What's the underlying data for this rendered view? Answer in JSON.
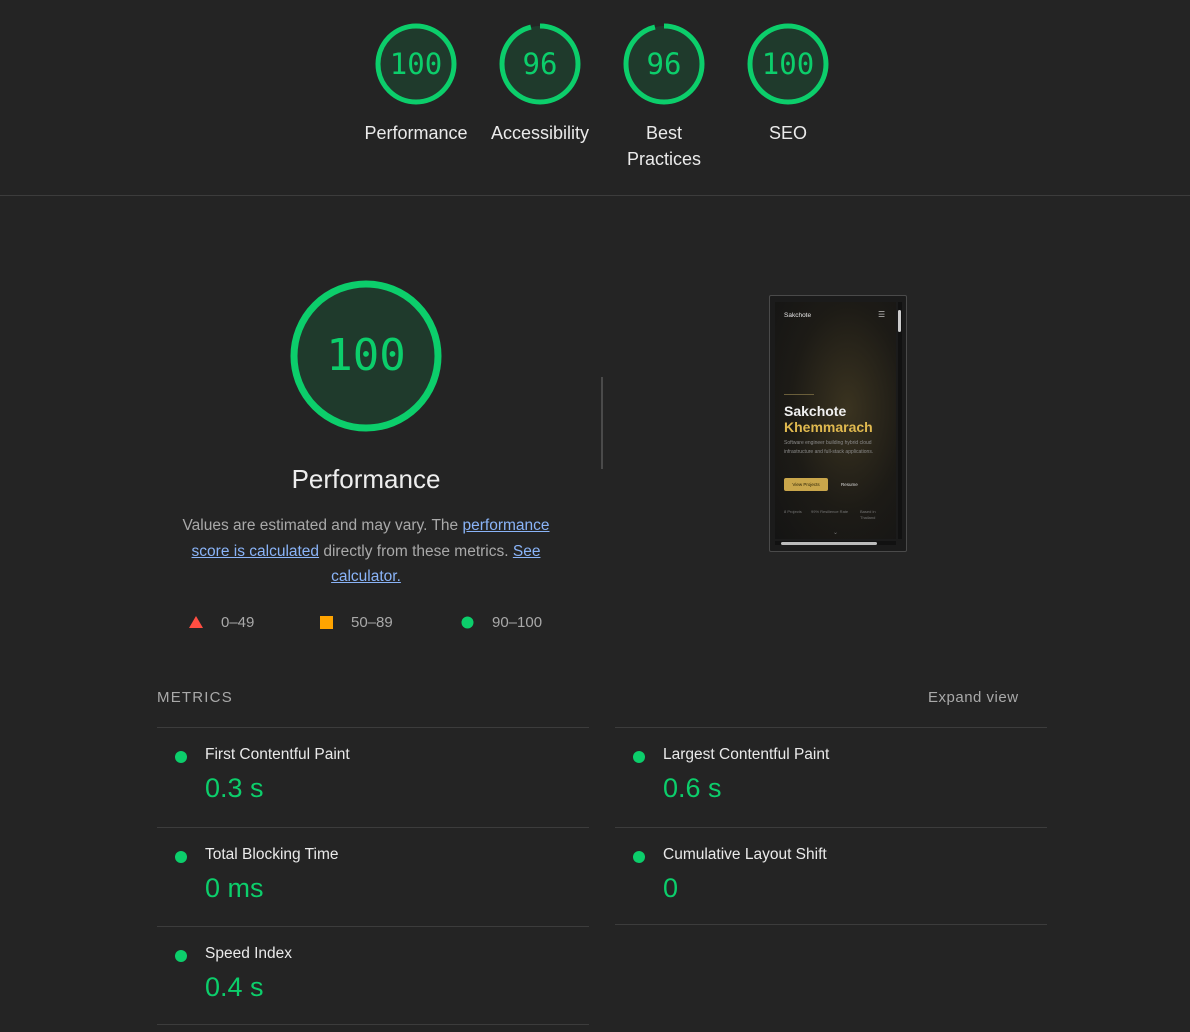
{
  "summary_gauges": [
    {
      "score": "100",
      "label_line1": "Performance",
      "label_line2": ""
    },
    {
      "score": "96",
      "label_line1": "Accessibility",
      "label_line2": ""
    },
    {
      "score": "96",
      "label_line1": "Best",
      "label_line2": "Practices"
    },
    {
      "score": "100",
      "label_line1": "SEO",
      "label_line2": ""
    }
  ],
  "performance": {
    "score": "100",
    "title": "Performance",
    "desc_prefix": "Values are estimated and may vary. The ",
    "desc_link1": "performance score is calculated",
    "desc_middle": " directly from these metrics. ",
    "desc_link2": "See calculator.",
    "legend": {
      "fail": "0–49",
      "average": "50–89",
      "pass": "90–100"
    }
  },
  "screenshot": {
    "brand": "Sakchote",
    "menu_icon": "☰",
    "name_first": "Sakchote",
    "name_last": "Khemmarach",
    "tagline": "Software engineer building hybrid cloud infrastructure and full-stack applications.",
    "primary_button": "View Projects",
    "secondary_button": "Resume",
    "stats": [
      "8 Projects",
      "99% Resilience Rate",
      "Based in Thailand"
    ],
    "chevron": "⌄"
  },
  "metrics": {
    "heading": "METRICS",
    "expand_label": "Expand view",
    "items": [
      {
        "name": "First Contentful Paint",
        "value": "0.3 s"
      },
      {
        "name": "Largest Contentful Paint",
        "value": "0.6 s"
      },
      {
        "name": "Total Blocking Time",
        "value": "0 ms"
      },
      {
        "name": "Cumulative Layout Shift",
        "value": "0"
      },
      {
        "name": "Speed Index",
        "value": "0.4 s"
      }
    ]
  },
  "colors": {
    "pass": "#0cce6b",
    "average": "#ffa400",
    "fail": "#ff4e42",
    "link": "#8ab4f8",
    "background": "#242424"
  }
}
